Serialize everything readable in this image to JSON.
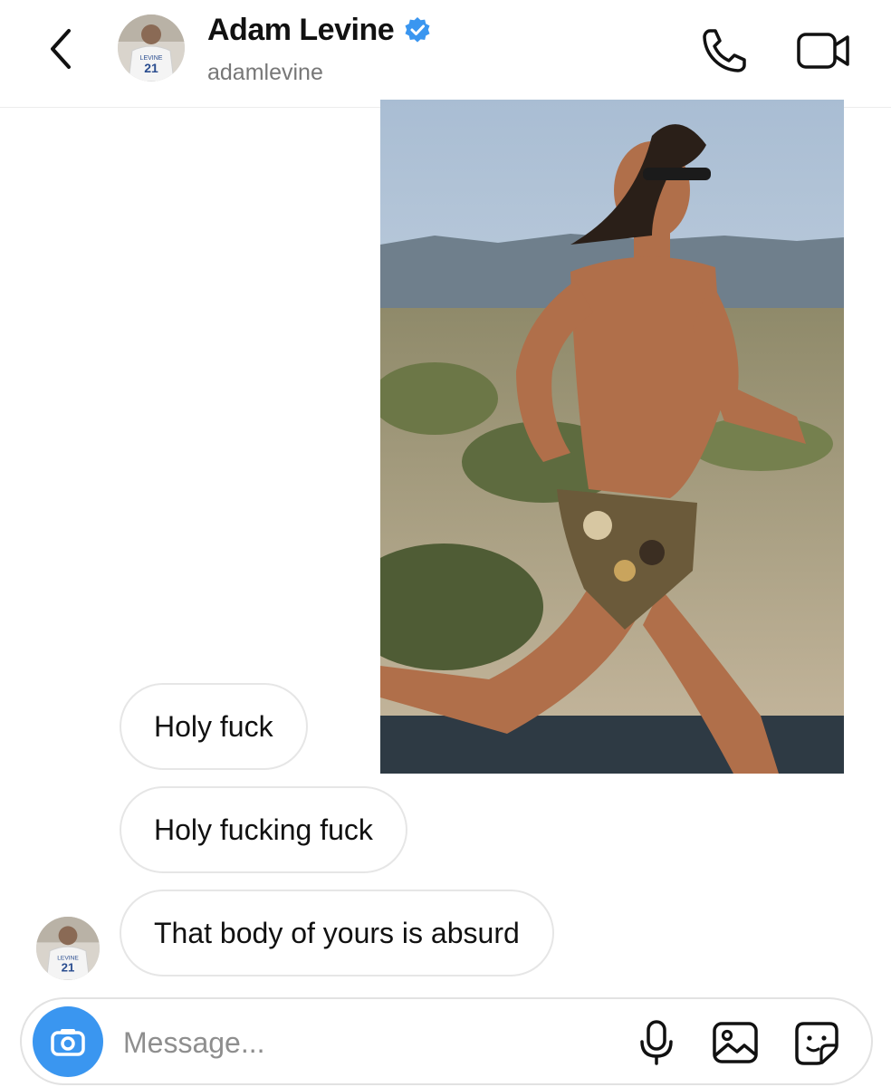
{
  "header": {
    "back_icon": "chevron-left-icon",
    "name": "Adam Levine",
    "verified_icon": "verified-badge-icon",
    "handle": "adamlevine",
    "call_icon": "phone-icon",
    "video_icon": "video-camera-icon",
    "avatar_jersey_text": "LEVINE",
    "avatar_jersey_number": "21"
  },
  "conversation": {
    "shared_photo": "photo of a shirtless man in sunglasses and patterned shorts running outdoors in the desert",
    "messages": [
      {
        "text": "Holy fuck"
      },
      {
        "text": "Holy fucking fuck"
      },
      {
        "text": "That body of yours is absurd"
      }
    ],
    "avatar_jersey_text": "LEVINE",
    "avatar_jersey_number": "21"
  },
  "composer": {
    "camera_icon": "camera-icon",
    "placeholder": "Message...",
    "mic_icon": "microphone-icon",
    "gallery_icon": "image-icon",
    "sticker_icon": "sticker-icon"
  },
  "colors": {
    "accent": "#3a96f0",
    "bubble_border": "#e6e6e6",
    "secondary_text": "#777777"
  }
}
